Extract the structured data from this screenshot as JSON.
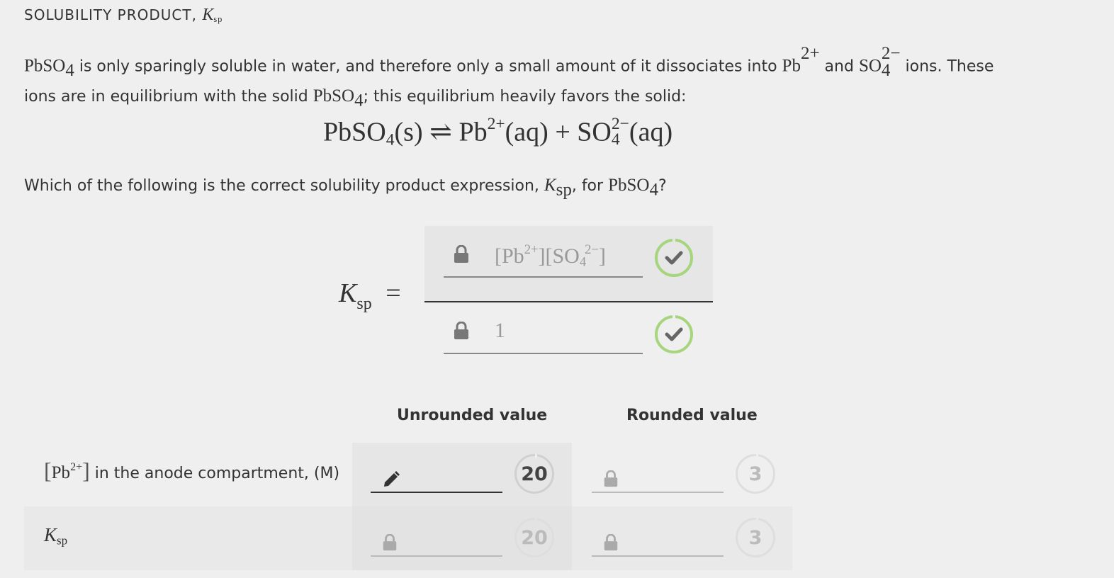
{
  "header": {
    "title_prefix": "SOLUBILITY PRODUCT, ",
    "k_symbol": "K",
    "k_sub": "sp"
  },
  "intro": {
    "compound": "PbSO",
    "compound_sub": "4",
    "text_1": " is only sparingly soluble in water, and therefore only a small amount of it dissociates into ",
    "ion1": "Pb",
    "ion1_charge": "2+",
    "text_2": " and ",
    "ion2": "SO",
    "ion2_charge": "2−",
    "ion2_sub": "4",
    "text_3": " ions. These ions are in equilibrium with the solid ",
    "text_4": "; this equilibrium heavily favors the solid:"
  },
  "equation": {
    "reactant": "PbSO",
    "reactant_sub": "4",
    "reactant_state": "(s)",
    "arrow": "⇌",
    "product1": "Pb",
    "product1_charge": "2+",
    "product1_state": "(aq)",
    "plus": "+",
    "product2": "SO",
    "product2_charge": "2−",
    "product2_sub": "4",
    "product2_state": "(aq)"
  },
  "question": {
    "text": "Which of the following is the correct solubility product expression, ",
    "k": "K",
    "k_sub": "sp",
    "text_2": ", for ",
    "compound": "PbSO",
    "compound_sub": "4",
    "end": "?"
  },
  "answer": {
    "k": "K",
    "k_sub": "sp",
    "equals": "=",
    "numerator": {
      "p1": "[Pb",
      "c1": "2+",
      "p2": "][SO",
      "s2": "4",
      "c2": "2−",
      "p3": "]"
    },
    "denominator": "1",
    "numerator_status": "correct",
    "denominator_status": "correct"
  },
  "table": {
    "col_unrounded": "Unrounded value",
    "col_rounded": "Rounded value",
    "rows": [
      {
        "label_pre": "Pb",
        "label_charge": "2+",
        "label_text": " in the anode compartment, (M)",
        "unrounded_badge": "20",
        "rounded_badge": "3"
      },
      {
        "label_k": "K",
        "label_k_sub": "sp",
        "unrounded_badge": "20",
        "rounded_badge": "3"
      }
    ]
  },
  "colors": {
    "check_green": "#a6d57e",
    "background": "#efefef",
    "cell_bg": "#e6e6e6"
  },
  "icons": [
    "lock-icon",
    "check-icon",
    "pencil-icon"
  ]
}
